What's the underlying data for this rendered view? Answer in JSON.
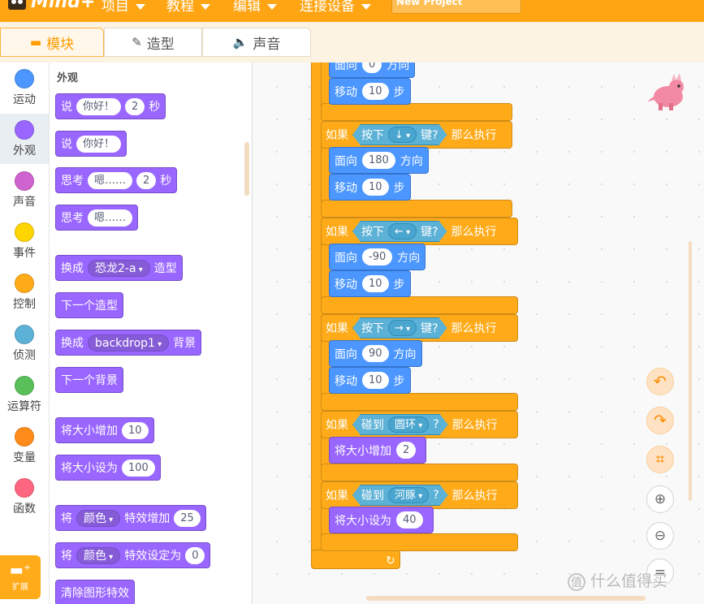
{
  "app": {
    "logo_text": "Mind+",
    "project_name": "New Project"
  },
  "menu": [
    "项目",
    "教程",
    "编辑",
    "连接设备"
  ],
  "tabs": [
    {
      "label": "模块",
      "icon": "blocks-icon",
      "active": true
    },
    {
      "label": "造型",
      "icon": "brush-icon",
      "active": false
    },
    {
      "label": "声音",
      "icon": "speaker-icon",
      "active": false
    }
  ],
  "categories": [
    {
      "label": "运动",
      "color": "#4c97ff"
    },
    {
      "label": "外观",
      "color": "#9966ff"
    },
    {
      "label": "声音",
      "color": "#cf63cf"
    },
    {
      "label": "事件",
      "color": "#ffd500"
    },
    {
      "label": "控制",
      "color": "#ffab19"
    },
    {
      "label": "侦测",
      "color": "#5cb1d6"
    },
    {
      "label": "运算符",
      "color": "#59c059"
    },
    {
      "label": "变量",
      "color": "#ff8c1a"
    },
    {
      "label": "函数",
      "color": "#ff6680"
    }
  ],
  "extension_label": "扩展",
  "palette": {
    "section_title": "外观",
    "say_secs": {
      "say": "说",
      "text": "你好！",
      "secs": "2",
      "unit": "秒"
    },
    "say": {
      "say": "说",
      "text": "你好！"
    },
    "think_secs": {
      "think": "思考",
      "text": "嗯……",
      "secs": "2",
      "unit": "秒"
    },
    "think": {
      "think": "思考",
      "text": "嗯……"
    },
    "switch_costume": {
      "label": "换成",
      "value": "恐龙2-a",
      "suffix": "造型"
    },
    "next_costume": "下一个造型",
    "switch_backdrop": {
      "label": "换成",
      "value": "backdrop1",
      "suffix": "背景"
    },
    "next_backdrop": "下一个背景",
    "change_size": {
      "label": "将大小增加",
      "value": "10"
    },
    "set_size": {
      "label": "将大小设为",
      "value": "100"
    },
    "change_effect": {
      "label": "将",
      "effect": "颜色",
      "suffix": "特效增加",
      "value": "25"
    },
    "set_effect": {
      "label": "将",
      "effect": "颜色",
      "suffix": "特效设定为",
      "value": "0"
    },
    "clear_effects": "清除图形特效"
  },
  "script": {
    "top_face": {
      "label": "面向",
      "value": "0",
      "suffix": "方向"
    },
    "top_move": {
      "label": "移动",
      "value": "10",
      "suffix": "步"
    },
    "if_blocks": [
      {
        "if": "如果",
        "cond_label": "按下",
        "cond_value": "↓",
        "cond_suffix": "键?",
        "then": "那么执行",
        "face": {
          "label": "面向",
          "value": "180",
          "suffix": "方向"
        },
        "move": {
          "label": "移动",
          "value": "10",
          "suffix": "步"
        }
      },
      {
        "if": "如果",
        "cond_label": "按下",
        "cond_value": "←",
        "cond_suffix": "键?",
        "then": "那么执行",
        "face": {
          "label": "面向",
          "value": "-90",
          "suffix": "方向"
        },
        "move": {
          "label": "移动",
          "value": "10",
          "suffix": "步"
        }
      },
      {
        "if": "如果",
        "cond_label": "按下",
        "cond_value": "→",
        "cond_suffix": "键?",
        "then": "那么执行",
        "face": {
          "label": "面向",
          "value": "90",
          "suffix": "方向"
        },
        "move": {
          "label": "移动",
          "value": "10",
          "suffix": "步"
        }
      },
      {
        "if": "如果",
        "cond_label": "碰到",
        "cond_value": "圆环",
        "cond_suffix": "?",
        "then": "那么执行",
        "action": {
          "label": "将大小增加",
          "value": "2"
        }
      },
      {
        "if": "如果",
        "cond_label": "碰到",
        "cond_value": "河豚",
        "cond_suffix": "?",
        "then": "那么执行",
        "action": {
          "label": "将大小设为",
          "value": "40"
        }
      }
    ],
    "loop_arrow": "↻"
  },
  "controls": [
    "undo-icon",
    "redo-icon",
    "crop-icon",
    "zoom-in-icon",
    "zoom-out-icon",
    "reset-zoom-icon"
  ],
  "watermark": "什么值得买"
}
